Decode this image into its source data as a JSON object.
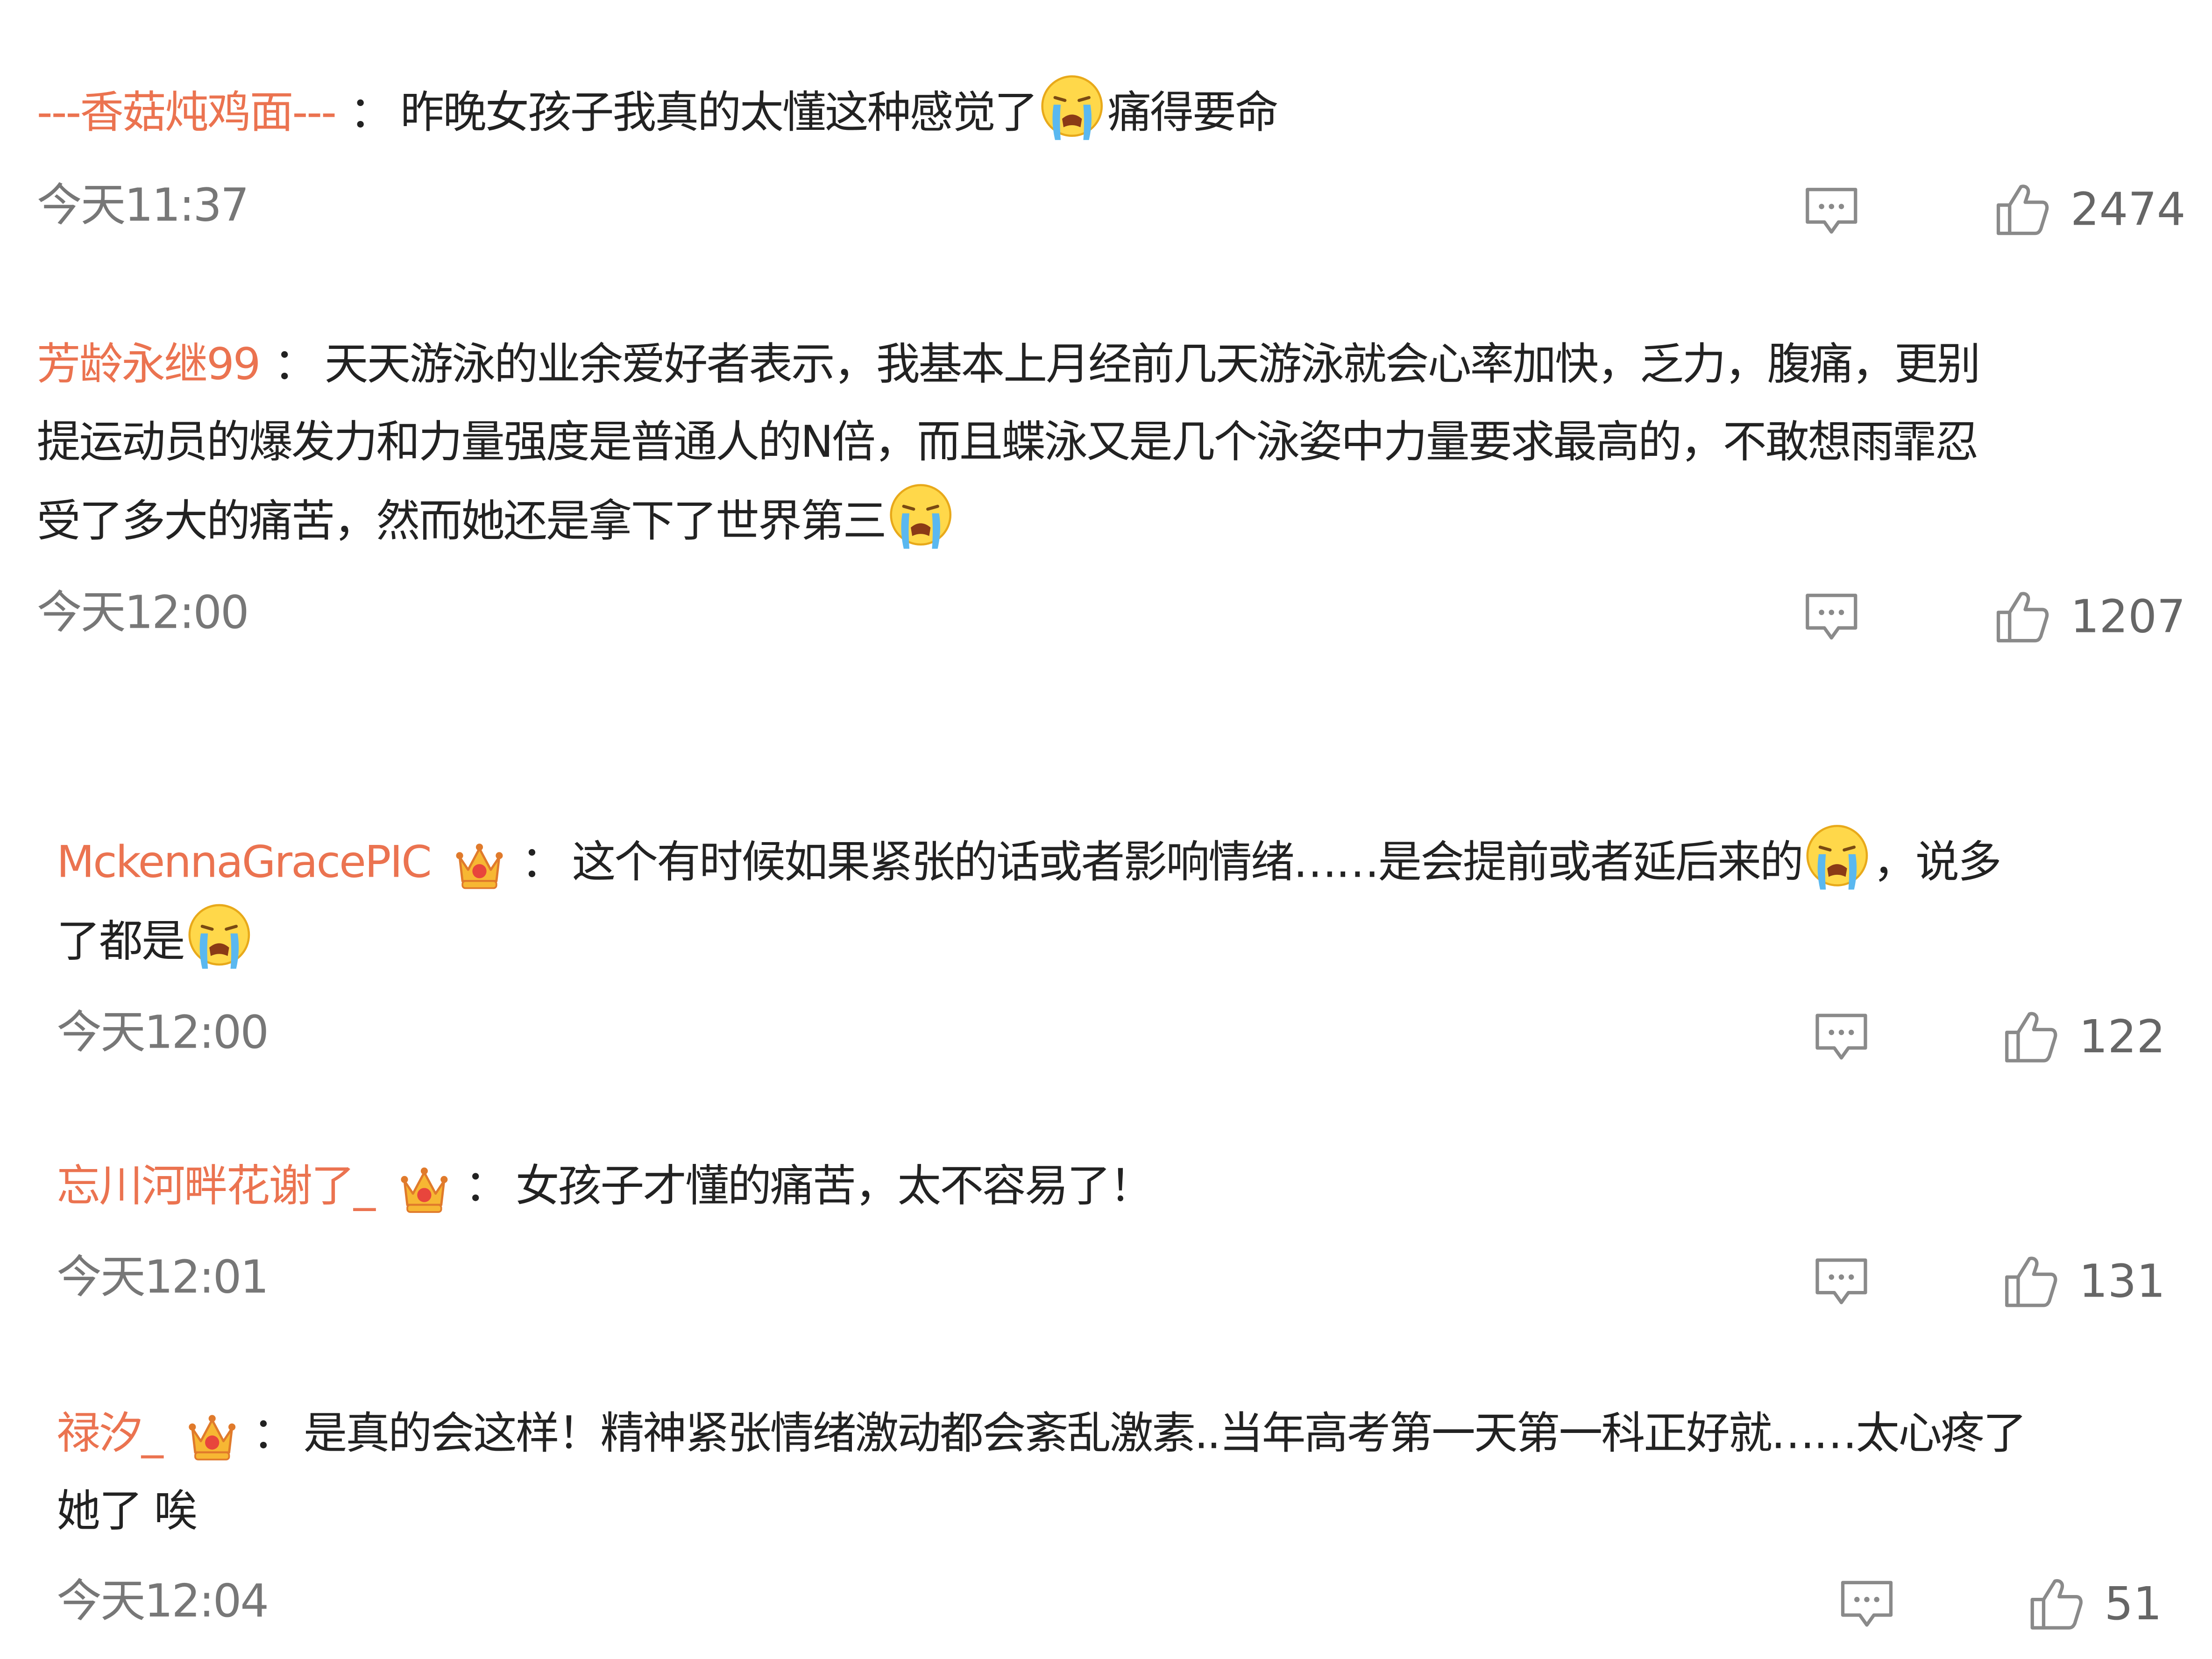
{
  "icons": {
    "reply": "comment-reply-icon",
    "like": "thumbs-up-icon",
    "emoji": "crying-face-emoji-icon",
    "crown": "crown-badge-icon"
  },
  "colors": {
    "username": "#eb7350",
    "text": "#222222",
    "timestamp": "#777777",
    "count": "#666666"
  },
  "comments": [
    {
      "username": "---香菇炖鸡面---",
      "colon": "：",
      "text_a": "昨晚女孩子我真的太懂这种感觉了",
      "text_b": "痛得要命",
      "time": "今天11:37",
      "likes": "2474"
    },
    {
      "username": "芳龄永继99",
      "colon": "：",
      "line1": "天天游泳的业余爱好者表示，我基本上月经前几天游泳就会心率加快，乏力，腹痛，更别",
      "line2": "提运动员的爆发力和力量强度是普通人的N倍，而且蝶泳又是几个泳姿中力量要求最高的，不敢想雨霏忍",
      "line3": "受了多大的痛苦，然而她还是拿下了世界第三",
      "time": "今天12:00",
      "likes": "1207"
    },
    {
      "username": "MckennaGracePIC",
      "colon": "：",
      "line1a": "这个有时候如果紧张的话或者影响情绪……是会提前或者延后来的",
      "line1b": "，说多",
      "line2": "了都是",
      "time": "今天12:00",
      "likes": "122"
    },
    {
      "username": "忘川河畔花谢了_",
      "colon": "：",
      "text": "女孩子才懂的痛苦，太不容易了！",
      "time": "今天12:01",
      "likes": "131"
    },
    {
      "username": "禄汐_",
      "colon": "：",
      "line1": "是真的会这样！精神紧张情绪激动都会紊乱激素..当年高考第一天第一科正好就……太心疼了",
      "line2": "她了 唉",
      "time": "今天12:04",
      "likes": "51"
    }
  ]
}
